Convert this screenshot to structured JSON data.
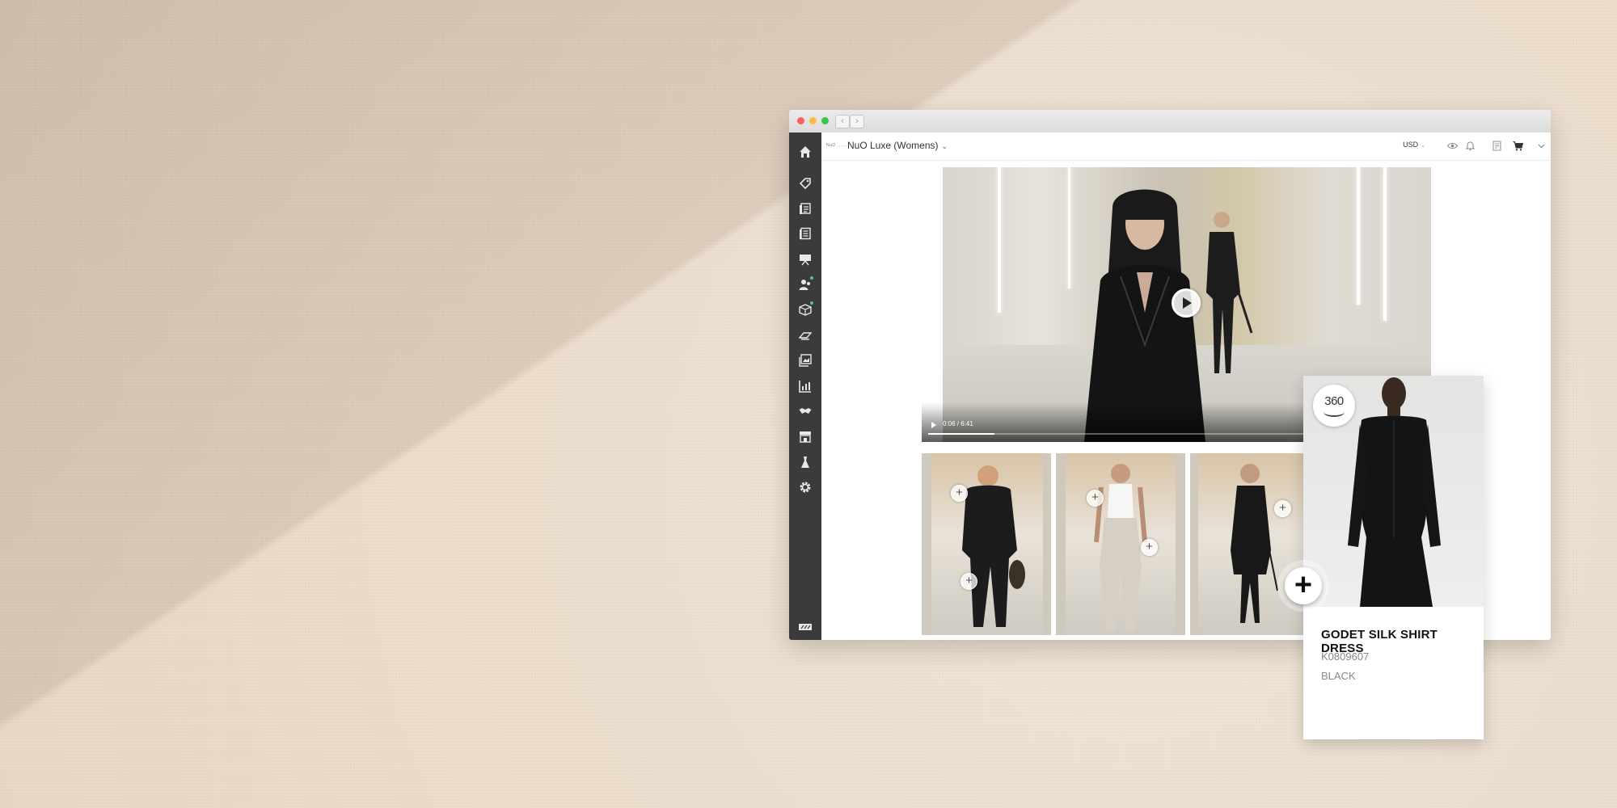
{
  "window": {
    "back_glyph": "‹",
    "forward_glyph": "›"
  },
  "sidebar": {
    "items": [
      {
        "icon": "home-icon"
      },
      {
        "icon": "tag-icon"
      },
      {
        "icon": "linesheet-icon"
      },
      {
        "icon": "catalog-icon"
      },
      {
        "icon": "presentation-icon"
      },
      {
        "icon": "contacts-icon"
      },
      {
        "icon": "orders-icon"
      },
      {
        "icon": "shipping-icon"
      },
      {
        "icon": "gallery-icon"
      },
      {
        "icon": "analytics-icon"
      },
      {
        "icon": "handshake-icon"
      },
      {
        "icon": "storefront-icon"
      },
      {
        "icon": "dress-icon"
      },
      {
        "icon": "settings-icon"
      },
      {
        "icon": "brand-logo-icon"
      }
    ]
  },
  "header": {
    "brand_small": "NuO ........",
    "store_name": "NuO Luxe (Womens)",
    "dropdown_glyph": "⌄",
    "currency": "USD",
    "currency_glyph": "⌄"
  },
  "video": {
    "time": "0:06 / 6:41",
    "progress": 0.16
  },
  "product": {
    "badge": "360",
    "name": "GODET SILK SHIRT DRESS",
    "sku": "K0809607",
    "color": "BLACK"
  },
  "add_glyph": "+"
}
